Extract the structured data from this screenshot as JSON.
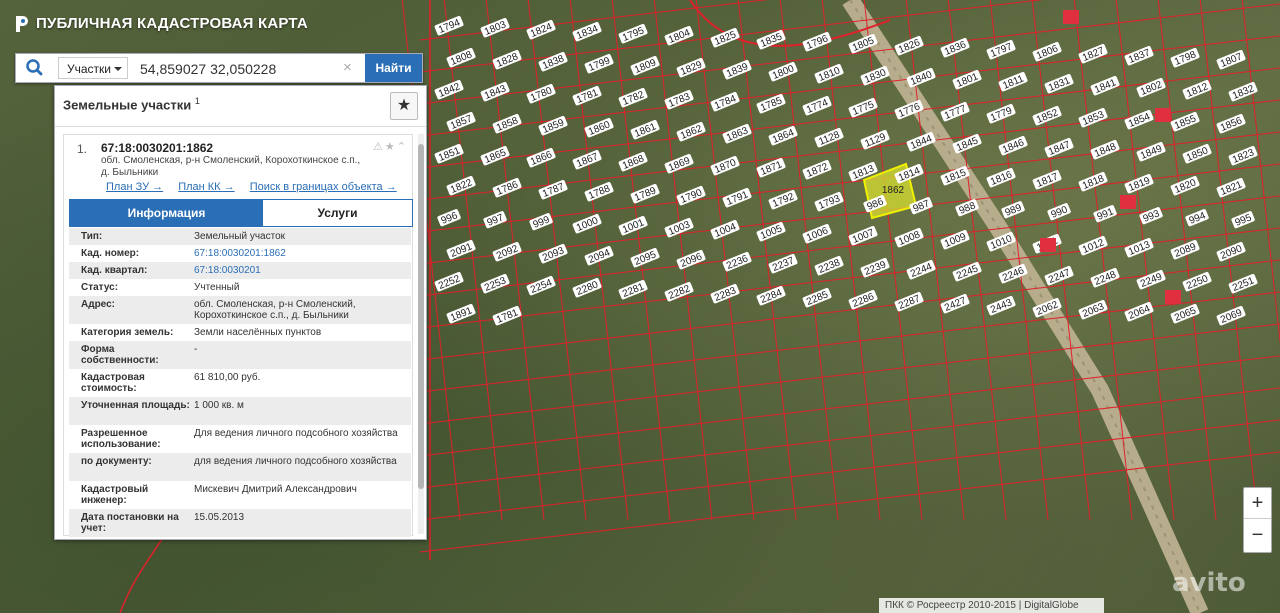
{
  "app": {
    "title": "ПУБЛИЧНАЯ КАДАСТРОВАЯ КАРТА"
  },
  "search": {
    "type_value": "Участки",
    "query": "54,859027 32,050228",
    "button_label": "Найти"
  },
  "panel": {
    "title": "Земельные участки",
    "title_count": "1",
    "result": {
      "index": "1.",
      "id": "67:18:0030201:1862",
      "address": "обл. Смоленская, р-н Смоленский, Корохоткинское с.п., д. Быльники",
      "links": [
        "План ЗУ →",
        "План КК →",
        "Поиск в границах объекта →"
      ],
      "tabs": [
        "Информация",
        "Услуги"
      ],
      "info": [
        {
          "key": "Тип:",
          "value": "Земельный участок"
        },
        {
          "key": "Кад. номер:",
          "value": "67:18:0030201:1862"
        },
        {
          "key": "Кад. квартал:",
          "value": "67:18:0030201"
        },
        {
          "key": "Статус:",
          "value": "Учтенный"
        },
        {
          "key": "Адрес:",
          "value": "обл. Смоленская, р-н Смоленский, Корохоткинское с.п., д. Быльники"
        },
        {
          "key": "Категория земель:",
          "value": "Земли населённых пунктов"
        },
        {
          "key": "Форма собственности:",
          "value": "-"
        },
        {
          "key": "Кадастровая стоимость:",
          "value": "61 810,00 руб."
        },
        {
          "key": "Уточненная площадь:",
          "value": "1 000 кв. м"
        },
        {
          "key": "Разрешенное использование:",
          "value": "Для ведения личного подсобного хозяйства"
        },
        {
          "key": "по документу:",
          "value": "для ведения личного подсобного хозяйства"
        },
        {
          "key": "Кадастровый инженер:",
          "value": "Мискевич Дмитрий Александрович"
        },
        {
          "key": "Дата постановки на учет:",
          "value": "15.05.2013"
        }
      ]
    }
  },
  "map": {
    "selected_parcel": "1862",
    "parcel_labels": [
      "1794",
      "1803",
      "1824",
      "1834",
      "1795",
      "1804",
      "1825",
      "1835",
      "1796",
      "1805",
      "1826",
      "1836",
      "1797",
      "1806",
      "1827",
      "1837",
      "1798",
      "1807",
      "1808",
      "1828",
      "1838",
      "1799",
      "1809",
      "1829",
      "1839",
      "1800",
      "1810",
      "1830",
      "1840",
      "1801",
      "1811",
      "1831",
      "1841",
      "1802",
      "1812",
      "1832",
      "1842",
      "1843",
      "1780",
      "1781",
      "1782",
      "1783",
      "1784",
      "1785",
      "1774",
      "1775",
      "1776",
      "1777",
      "1779",
      "1852",
      "1853",
      "1854",
      "1855",
      "1856",
      "1857",
      "1858",
      "1859",
      "1860",
      "1861",
      "1862",
      "1863",
      "1864",
      "1128",
      "1129",
      "1844",
      "1845",
      "1846",
      "1847",
      "1848",
      "1849",
      "1850",
      "1823",
      "1851",
      "1865",
      "1866",
      "1867",
      "1868",
      "1869",
      "1870",
      "1871",
      "1872",
      "1813",
      "1814",
      "1815",
      "1816",
      "1817",
      "1818",
      "1819",
      "1820",
      "1821",
      "1822",
      "1786",
      "1787",
      "1788",
      "1789",
      "1790",
      "1791",
      "1792",
      "1793",
      "986",
      "987",
      "988",
      "989",
      "990",
      "991",
      "993",
      "994",
      "995",
      "996",
      "997",
      "999",
      "1000",
      "1001",
      "1003",
      "1004",
      "1005",
      "1006",
      "1007",
      "1008",
      "1009",
      "1010",
      "1011",
      "1012",
      "1013",
      "2089",
      "2090",
      "2091",
      "2092",
      "2093",
      "2094",
      "2095",
      "2096",
      "2236",
      "2237",
      "2238",
      "2239",
      "2244",
      "2245",
      "2246",
      "2247",
      "2248",
      "2249",
      "2250",
      "2251",
      "2252",
      "2253",
      "2254",
      "2280",
      "2281",
      "2282",
      "2283",
      "2284",
      "2285",
      "2286",
      "2287",
      "2427",
      "2443",
      "2062",
      "2063",
      "2064",
      "2065",
      "2069",
      "1891",
      "1781"
    ],
    "zoom_in": "+",
    "zoom_out": "−",
    "copyright": "ПКК © Росреестр 2010-2015 | DigitalGlobe",
    "watermark": "avito"
  },
  "colors": {
    "accent": "#2a6eb5",
    "parcel_border": "#e0202a",
    "selected_fill": "#d8e030"
  }
}
